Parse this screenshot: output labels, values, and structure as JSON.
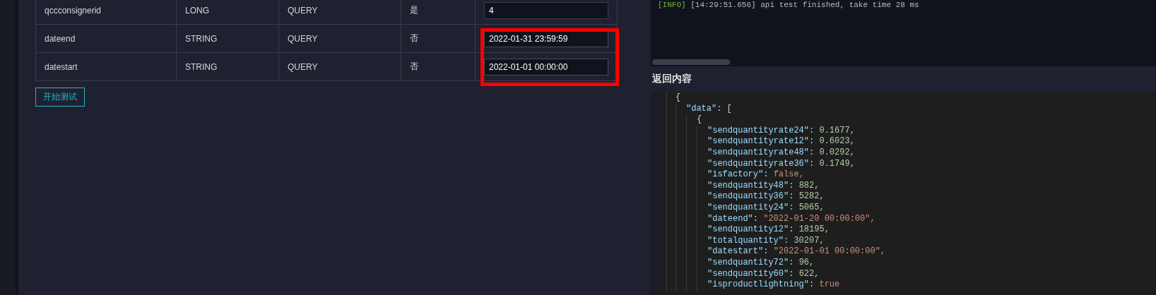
{
  "params_table": {
    "rows": [
      {
        "name": "qccconsignerid",
        "type": "LONG",
        "location": "QUERY",
        "required": "是",
        "value": "4",
        "highlighted": false
      },
      {
        "name": "dateend",
        "type": "STRING",
        "location": "QUERY",
        "required": "否",
        "value": "2022-01-31 23:59:59",
        "highlighted": true
      },
      {
        "name": "datestart",
        "type": "STRING",
        "location": "QUERY",
        "required": "否",
        "value": "2022-01-01 00:00:00",
        "highlighted": true
      }
    ]
  },
  "highlight": {
    "color": "#ff0000"
  },
  "start_button": {
    "label": "开始测试"
  },
  "log": {
    "lines": [
      {
        "level": "[INFO]",
        "message": " [14:29:51.656] api test finished, take time 28 ms"
      }
    ]
  },
  "response": {
    "title": "返回内容",
    "tree": [
      {
        "text": "{",
        "children": [
          {
            "key": "\"data\": ",
            "value": "[",
            "kind": "punct",
            "children": [
              {
                "text": "{",
                "children": [
                  {
                    "key": "\"sendquantityrate24\": ",
                    "value": "0.1677,",
                    "kind": "number"
                  },
                  {
                    "key": "\"sendquantityrate12\": ",
                    "value": "0.6023,",
                    "kind": "number"
                  },
                  {
                    "key": "\"sendquantityrate48\": ",
                    "value": "0.0292,",
                    "kind": "number"
                  },
                  {
                    "key": "\"sendquantityrate36\": ",
                    "value": "0.1749,",
                    "kind": "number"
                  },
                  {
                    "key": "\"isfactory\": ",
                    "value": "false,",
                    "kind": "bool"
                  },
                  {
                    "key": "\"sendquantity48\": ",
                    "value": "882,",
                    "kind": "number"
                  },
                  {
                    "key": "\"sendquantity36\": ",
                    "value": "5282,",
                    "kind": "number"
                  },
                  {
                    "key": "\"sendquantity24\": ",
                    "value": "5065,",
                    "kind": "number"
                  },
                  {
                    "key": "\"dateend\": ",
                    "value": "\"2022-01-20 00:00:00\",",
                    "kind": "string"
                  },
                  {
                    "key": "\"sendquantity12\": ",
                    "value": "18195,",
                    "kind": "number"
                  },
                  {
                    "key": "\"totalquantity\": ",
                    "value": "30207,",
                    "kind": "number"
                  },
                  {
                    "key": "\"datestart\": ",
                    "value": "\"2022-01-01 00:00:00\",",
                    "kind": "string"
                  },
                  {
                    "key": "\"sendquantity72\": ",
                    "value": "96,",
                    "kind": "number"
                  },
                  {
                    "key": "\"sendquantity60\": ",
                    "value": "622,",
                    "kind": "number"
                  },
                  {
                    "key": "\"isproductlightning\": ",
                    "value": "true",
                    "kind": "bool"
                  }
                ]
              }
            ]
          }
        ]
      }
    ]
  }
}
